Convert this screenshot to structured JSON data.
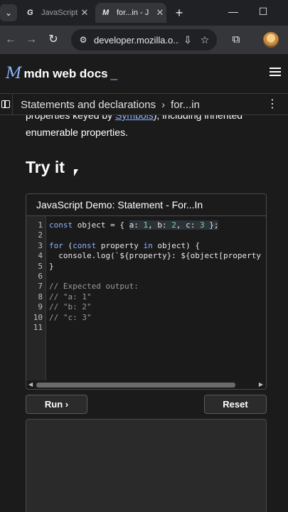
{
  "browser": {
    "tab_menu_icon": "chevron-down-icon",
    "tabs": [
      {
        "favicon": "G",
        "title": "JavaScript"
      },
      {
        "favicon": "M",
        "title": "for...in - J"
      }
    ],
    "url": "developer.mozilla.o..."
  },
  "mdn": {
    "logo_mark": "M",
    "logo_text": "mdn web docs",
    "logo_caret": "_",
    "breadcrumb": [
      "Statements and declarations",
      "for...in"
    ]
  },
  "article": {
    "intro_before": "properties keyed by ",
    "intro_link": "Symbols",
    "intro_after": "), including inherited enumerable properties.",
    "heading": "Try it"
  },
  "demo": {
    "title": "JavaScript Demo: Statement - For...In",
    "line_numbers": [
      "1",
      "2",
      "3",
      "4",
      "5",
      "6",
      "7",
      "8",
      "9",
      "10",
      "11"
    ],
    "code": {
      "l1_a": "const",
      "l1_b": " object = { ",
      "l1_c": "a: ",
      "l1_d": "1",
      "l1_e": ", b: ",
      "l1_f": "2",
      "l1_g": ", c: ",
      "l1_h": "3",
      "l1_i": " };",
      "l3_a": "for",
      "l3_b": " (",
      "l3_c": "const",
      "l3_d": " property ",
      "l3_e": "in",
      "l3_f": " object) {",
      "l4": "  console.log(`${property}: ${object[property",
      "l5": "}",
      "l7": "// Expected output:",
      "l8": "// \"a: 1\"",
      "l9": "// \"b: 2\"",
      "l10": "// \"c: 3\""
    },
    "run_label": "Run ›",
    "reset_label": "Reset"
  }
}
